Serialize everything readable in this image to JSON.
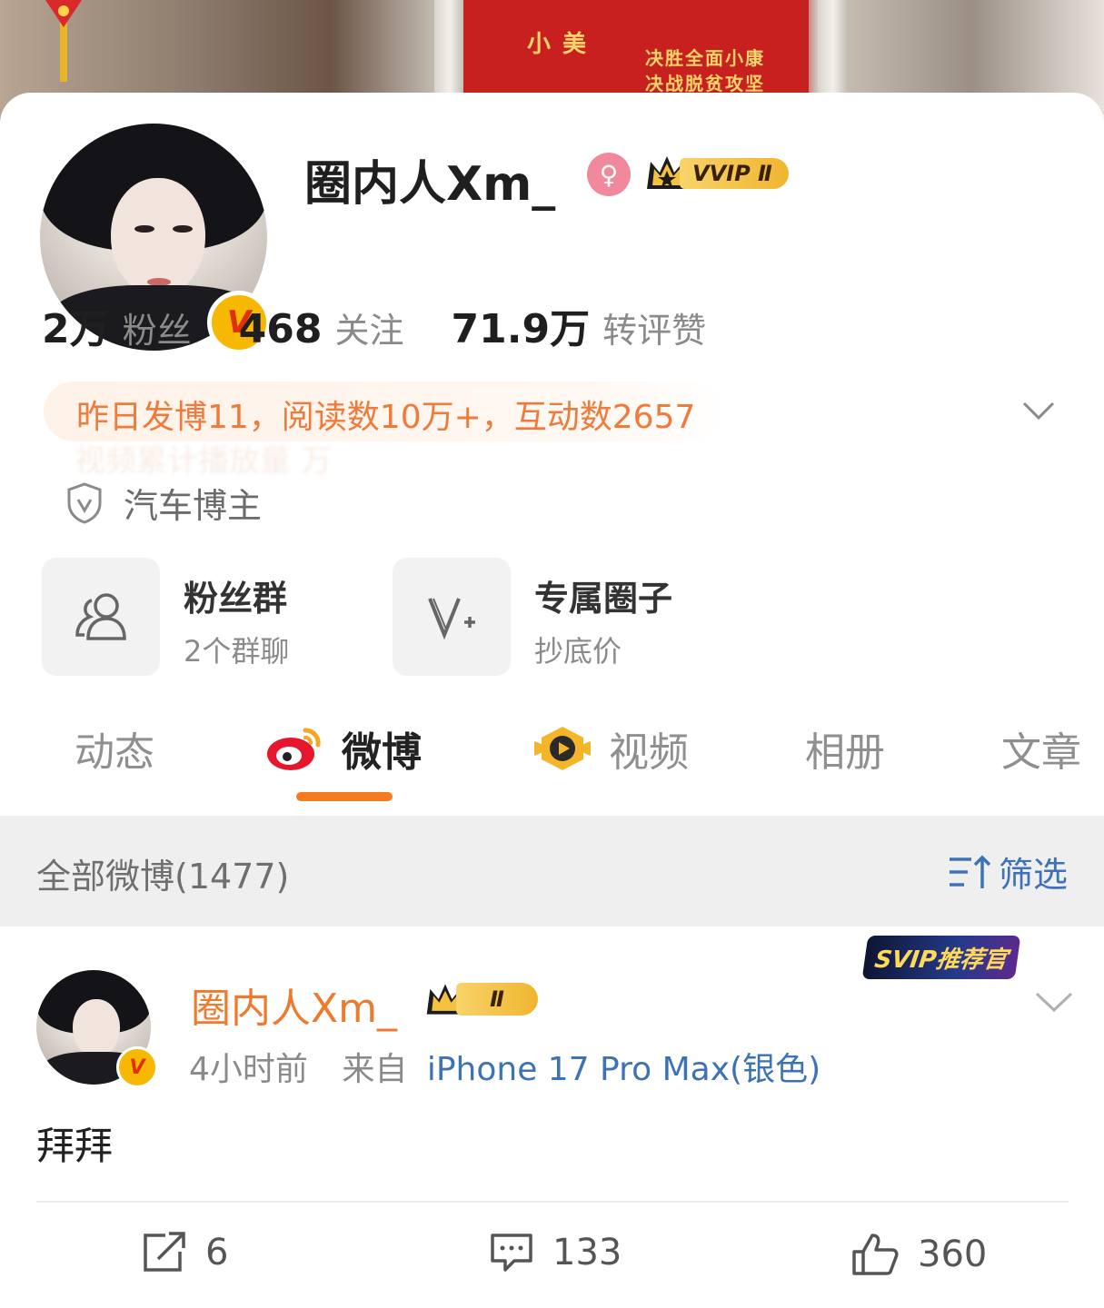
{
  "profile": {
    "name": "圈内人Xm_",
    "gender_icon": "female-icon",
    "vip_label": "VVIP Ⅱ",
    "stats": [
      {
        "value": "2万",
        "label": "粉丝"
      },
      {
        "value": "468",
        "label": "关注"
      },
      {
        "value": "71.9万",
        "label": "转评赞"
      }
    ],
    "activity": "昨日发博11，阅读数10万+，互动数2657",
    "activity_ghost": "视频累计播放量 万",
    "certification": "汽车博主"
  },
  "features": [
    {
      "title": "粉丝群",
      "subtitle": "2个群聊",
      "icon": "group-icon"
    },
    {
      "title": "专属圈子",
      "subtitle": "抄底价",
      "icon": "v-plus-icon"
    }
  ],
  "tabs": [
    {
      "label": "动态",
      "active": false
    },
    {
      "label": "微博",
      "active": true,
      "icon": "weibo-icon"
    },
    {
      "label": "视频",
      "active": false,
      "icon": "video-icon"
    },
    {
      "label": "相册",
      "active": false
    },
    {
      "label": "文章",
      "active": false
    }
  ],
  "feed": {
    "count_label": "全部微博(1477)",
    "filter_label": "筛选"
  },
  "post": {
    "author": "圈内人Xm_",
    "vip_label": "Ⅱ",
    "badge": "SVIP推荐官",
    "time": "4小时前",
    "source_prefix": "来自",
    "device": "iPhone 17 Pro Max(银色)",
    "text": "拜拜",
    "reposts": "6",
    "comments": "133",
    "likes": "360"
  },
  "colors": {
    "accent": "#f47b20",
    "link": "#3d72b6",
    "activity_text": "#f07a3a",
    "vip_gold": "#f0b52f"
  }
}
